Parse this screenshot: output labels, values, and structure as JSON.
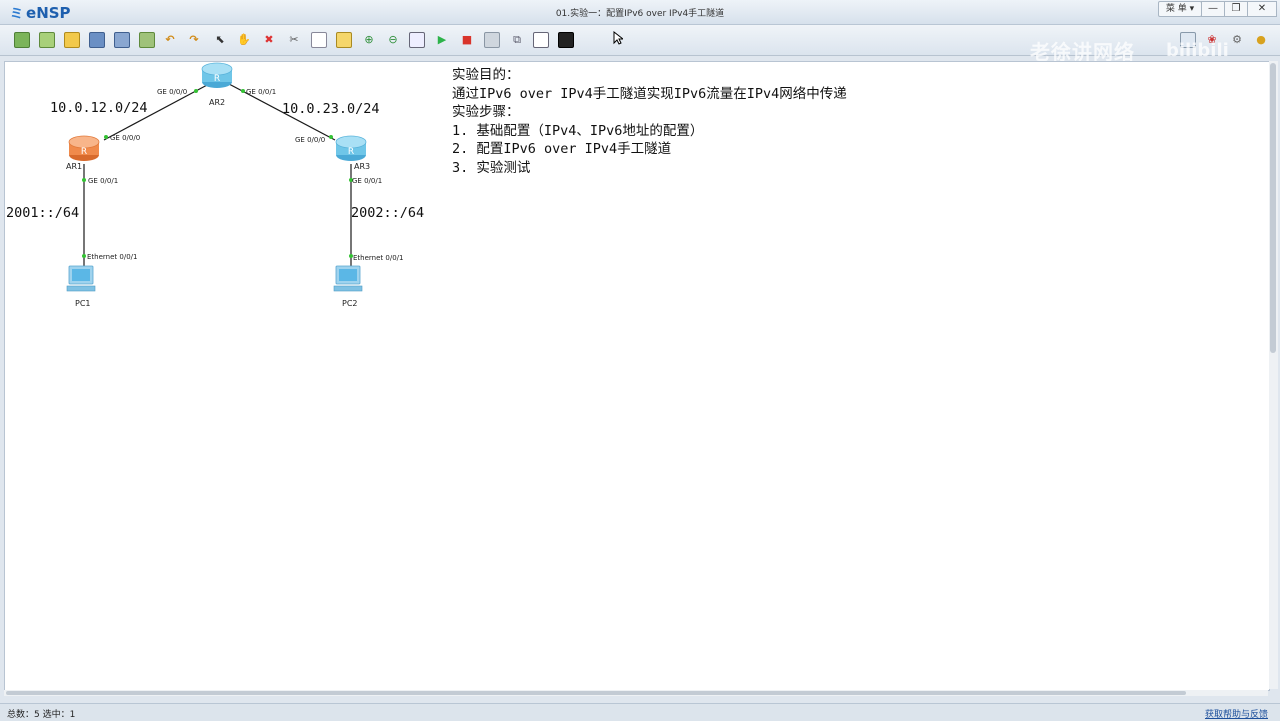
{
  "app": {
    "name": "eNSP",
    "window_title": "01.实验一：配置IPv6 over IPv4手工隧道",
    "menu_label": "菜 单",
    "min_glyph": "—",
    "max_glyph": "❐",
    "close_glyph": "✕"
  },
  "watermark": {
    "text": "老徐讲网络",
    "logo": "bilibili"
  },
  "topology": {
    "devices": [
      {
        "id": "AR2",
        "label": "AR2",
        "type": "router",
        "color": "#6fc6e8"
      },
      {
        "id": "AR1",
        "label": "AR1",
        "type": "router",
        "color": "#f08a4b"
      },
      {
        "id": "AR3",
        "label": "AR3",
        "type": "router",
        "color": "#6fc6e8"
      },
      {
        "id": "PC1",
        "label": "PC1",
        "type": "pc"
      },
      {
        "id": "PC2",
        "label": "PC2",
        "type": "pc"
      }
    ],
    "ports": {
      "ar2_g000": "GE 0/0/0",
      "ar2_g001": "GE 0/0/1",
      "ar1_g000": "GE 0/0/0",
      "ar1_g001": "GE 0/0/1",
      "ar3_g000": "GE 0/0/0",
      "ar3_g001": "GE 0/0/1",
      "pc1_eth": "Ethernet 0/0/1",
      "pc2_eth": "Ethernet 0/0/1"
    },
    "networks": {
      "ar1_ar2": "10.0.12.0/24",
      "ar2_ar3": "10.0.23.0/24",
      "ar1_pc1": "2001::/64",
      "ar3_pc2": "2002::/64"
    },
    "link_color": "#1a1a1a",
    "port_up_color": "#34c234"
  },
  "notes": {
    "lines": [
      "实验目的：",
      "通过IPv6 over IPv4手工隧道实现IPv6流量在IPv4网络中传递",
      "实验步骤：",
      "1. 基础配置（IPv4、IPv6地址的配置）",
      "2. 配置IPv6 over IPv4手工隧道",
      "3. 实验测试"
    ]
  },
  "status": {
    "left": "总数：5 选中：1",
    "right": "获取帮助与反馈"
  }
}
